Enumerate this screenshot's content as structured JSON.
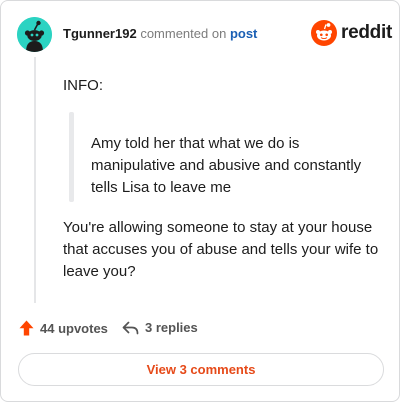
{
  "comment": {
    "username": "Tgunner192",
    "action_text": "commented on",
    "post_link": "post",
    "paragraphs": {
      "info": "INFO:",
      "quote": "Amy told her that what we do is manipulative and abusive and constantly tells Lisa to leave me",
      "main": "You're allowing someone to stay at your house that accuses you of abuse and tells your wife to leave you?"
    }
  },
  "brand": {
    "wordmark": "reddit",
    "accent_color": "#ff4500"
  },
  "stats": {
    "upvotes": "44 upvotes",
    "replies": "3 replies"
  },
  "footer": {
    "view_comments_label": "View 3 comments"
  },
  "icons": {
    "avatar": "snoo-avatar-icon",
    "logo": "reddit-logo-icon",
    "upvote": "upvote-arrow-icon",
    "reply": "reply-arrow-icon"
  }
}
